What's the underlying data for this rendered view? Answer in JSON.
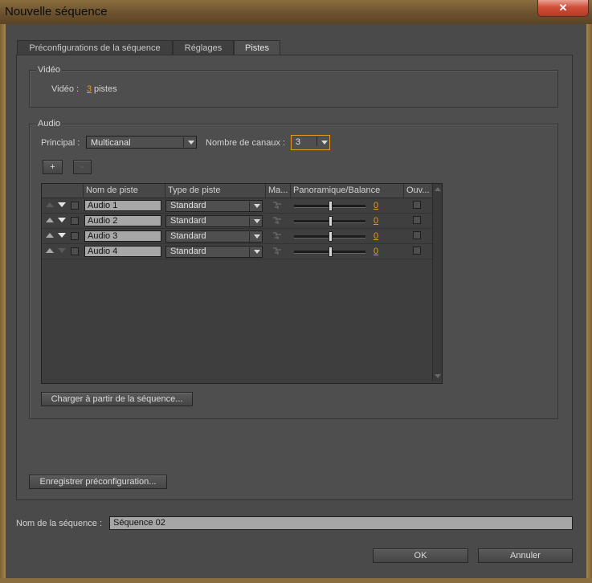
{
  "window": {
    "title": "Nouvelle séquence",
    "close_glyph": "✕"
  },
  "tabs": [
    {
      "label": "Préconfigurations de la séquence",
      "active": false
    },
    {
      "label": "Réglages",
      "active": false
    },
    {
      "label": "Pistes",
      "active": true
    }
  ],
  "video": {
    "group_label": "Vidéo",
    "field_label": "Vidéo :",
    "value": "3",
    "unit": "pistes"
  },
  "audio": {
    "group_label": "Audio",
    "principal_label": "Principal :",
    "principal_value": "Multicanal",
    "channels_label": "Nombre de canaux :",
    "channels_value": "3",
    "add_label": "+",
    "remove_label": "-",
    "columns": [
      "Nom de piste",
      "Type de piste",
      "Ma...",
      "Panoramique/Balance",
      "Ouv..."
    ],
    "tracks": [
      {
        "name": "Audio 1",
        "type": "Standard",
        "pan": "0",
        "pan_level": 0.5
      },
      {
        "name": "Audio 2",
        "type": "Standard",
        "pan": "0",
        "pan_level": 0.5
      },
      {
        "name": "Audio 3",
        "type": "Standard",
        "pan": "0",
        "pan_level": 0.5
      },
      {
        "name": "Audio 4",
        "type": "Standard",
        "pan": "0",
        "pan_level": 0.5
      }
    ],
    "load_button": "Charger à partir de la séquence..."
  },
  "save_preset_button": "Enregistrer préconfiguration...",
  "sequence_name": {
    "label": "Nom de la séquence :",
    "value": "Séquence 02"
  },
  "footer": {
    "ok_label": "OK",
    "cancel_label": "Annuler"
  },
  "colors": {
    "accent": "#e29a23",
    "dialog_bg": "#4a4a4a",
    "close_red": "#c8452f"
  }
}
